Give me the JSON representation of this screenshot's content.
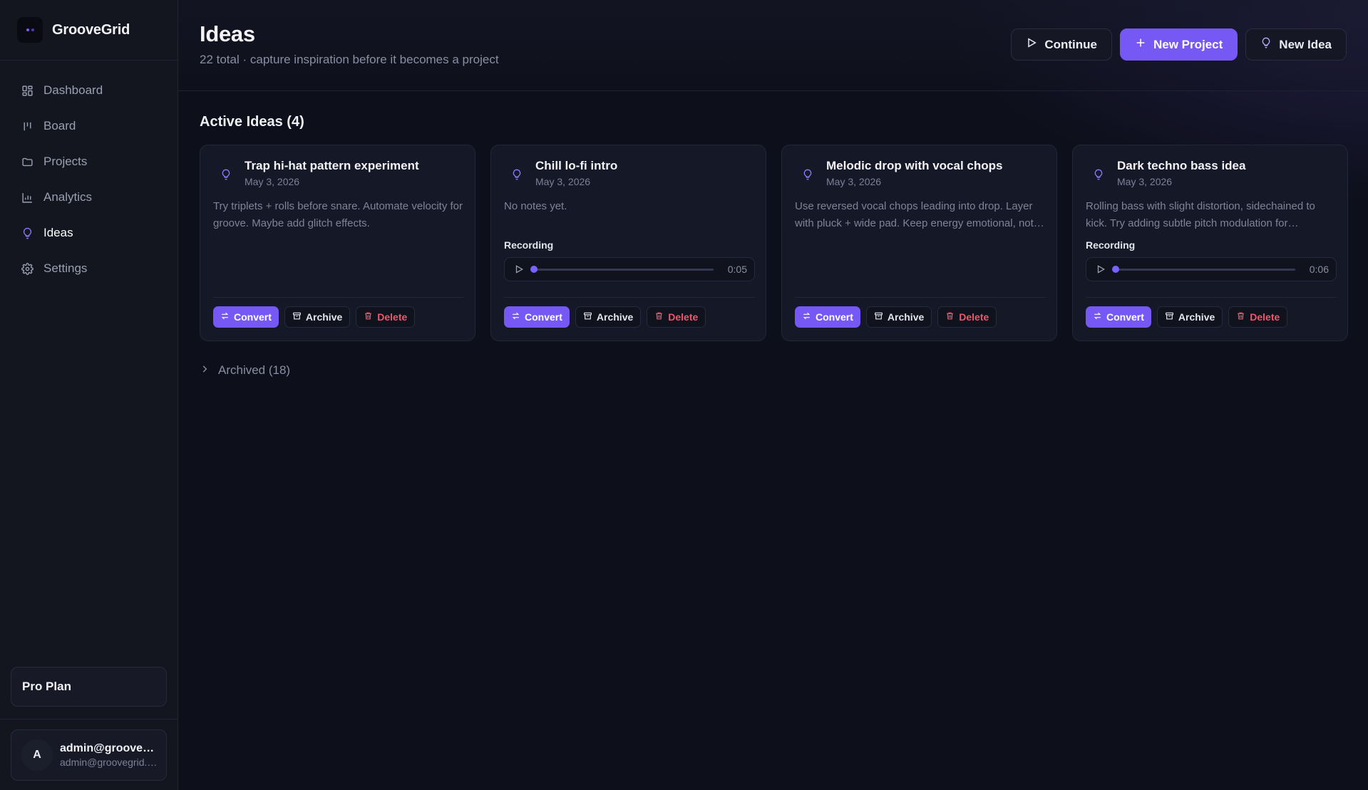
{
  "app": {
    "name": "GrooveGrid"
  },
  "colors": {
    "accent": "#7659f5",
    "danger": "#f0566a",
    "background": "#0d0f1a",
    "sidebar": "#13151f"
  },
  "sidebar": {
    "items": [
      {
        "label": "Dashboard",
        "icon": "dashboard-icon"
      },
      {
        "label": "Board",
        "icon": "board-icon"
      },
      {
        "label": "Projects",
        "icon": "folder-icon"
      },
      {
        "label": "Analytics",
        "icon": "chart-icon"
      },
      {
        "label": "Ideas",
        "icon": "lightbulb-icon",
        "active": true
      },
      {
        "label": "Settings",
        "icon": "gear-icon"
      }
    ],
    "plan": "Pro Plan",
    "user": {
      "initial": "A",
      "name": "admin@groovegrid.com",
      "email": "admin@groovegrid.com"
    }
  },
  "header": {
    "title": "Ideas",
    "subtitle": "22 total · capture inspiration before it becomes a project",
    "continue_label": "Continue",
    "new_project_label": "New Project",
    "new_idea_label": "New Idea"
  },
  "section": {
    "title": "Active Ideas (4)"
  },
  "ideas": [
    {
      "title": "Trap hi-hat pattern experiment",
      "date": "May 3, 2026",
      "notes": "Try triplets + rolls before snare. Automate velocity for groove. Maybe add glitch effects.",
      "has_recording": false
    },
    {
      "title": "Chill lo-fi intro",
      "date": "May 3, 2026",
      "notes": "No notes yet.",
      "has_recording": true,
      "recording_label": "Recording",
      "duration": "0:05",
      "progress": 0
    },
    {
      "title": "Melodic drop with vocal chops",
      "date": "May 3, 2026",
      "notes": "Use reversed vocal chops leading into drop. Layer with pluck + wide pad. Keep energy emotional, not too aggressive.",
      "has_recording": false
    },
    {
      "title": "Dark techno bass idea",
      "date": "May 3, 2026",
      "notes": "Rolling bass with slight distortion, sidechained to kick. Try adding subtle pitch modulation for movement.",
      "has_recording": true,
      "recording_label": "Recording",
      "duration": "0:06",
      "progress": 0
    }
  ],
  "card_actions": {
    "convert": "Convert",
    "archive": "Archive",
    "delete": "Delete"
  },
  "archived": {
    "label": "Archived (18)"
  }
}
